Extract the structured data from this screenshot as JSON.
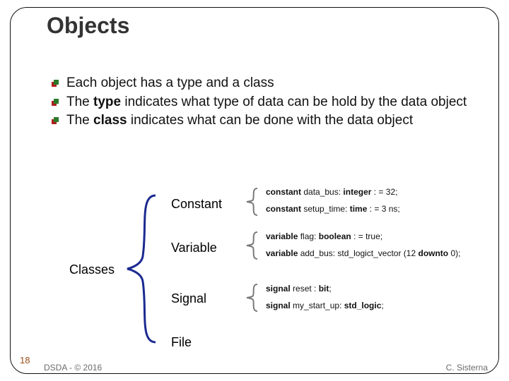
{
  "title": "Objects",
  "bullets": [
    {
      "pre": "Each object has a type and a class",
      "bold": "",
      "post": ""
    },
    {
      "pre": "The ",
      "bold": "type",
      "post": " indicates what type of data can be hold by the data object"
    },
    {
      "pre": "The ",
      "bold": "class",
      "post": " indicates what can be done with the data object"
    }
  ],
  "classes_label": "Classes",
  "class_names": {
    "constant": "Constant",
    "variable": "Variable",
    "signal": "Signal",
    "file": "File"
  },
  "code": {
    "constant": {
      "l1": {
        "kw1": "constant",
        "t1": " data_bus: ",
        "kw2": "integer",
        "t2": " : = 32;"
      },
      "l2": {
        "kw1": "constant",
        "t1": " setup_time: ",
        "kw2": "time",
        "t2": " : = 3 ns;"
      }
    },
    "variable": {
      "l1": {
        "kw1": "variable",
        "t1": " flag: ",
        "kw2": "boolean",
        "t2": " : = true;"
      },
      "l2": {
        "kw1": "variable",
        "t1": " add_bus: std_logict_vector (12 ",
        "kw2": "downto",
        "t2": " 0);"
      }
    },
    "signal": {
      "l1": {
        "kw1": "signal",
        "t1": "  reset : ",
        "kw2": "bit",
        "t2": ";"
      },
      "l2": {
        "kw1": "signal",
        "t1": " my_start_up: ",
        "kw2": "std_logic",
        "t2": ";"
      }
    }
  },
  "slide_number": "18",
  "footer_left": "DSDA - © 2016",
  "footer_right": "C. Sisterna"
}
